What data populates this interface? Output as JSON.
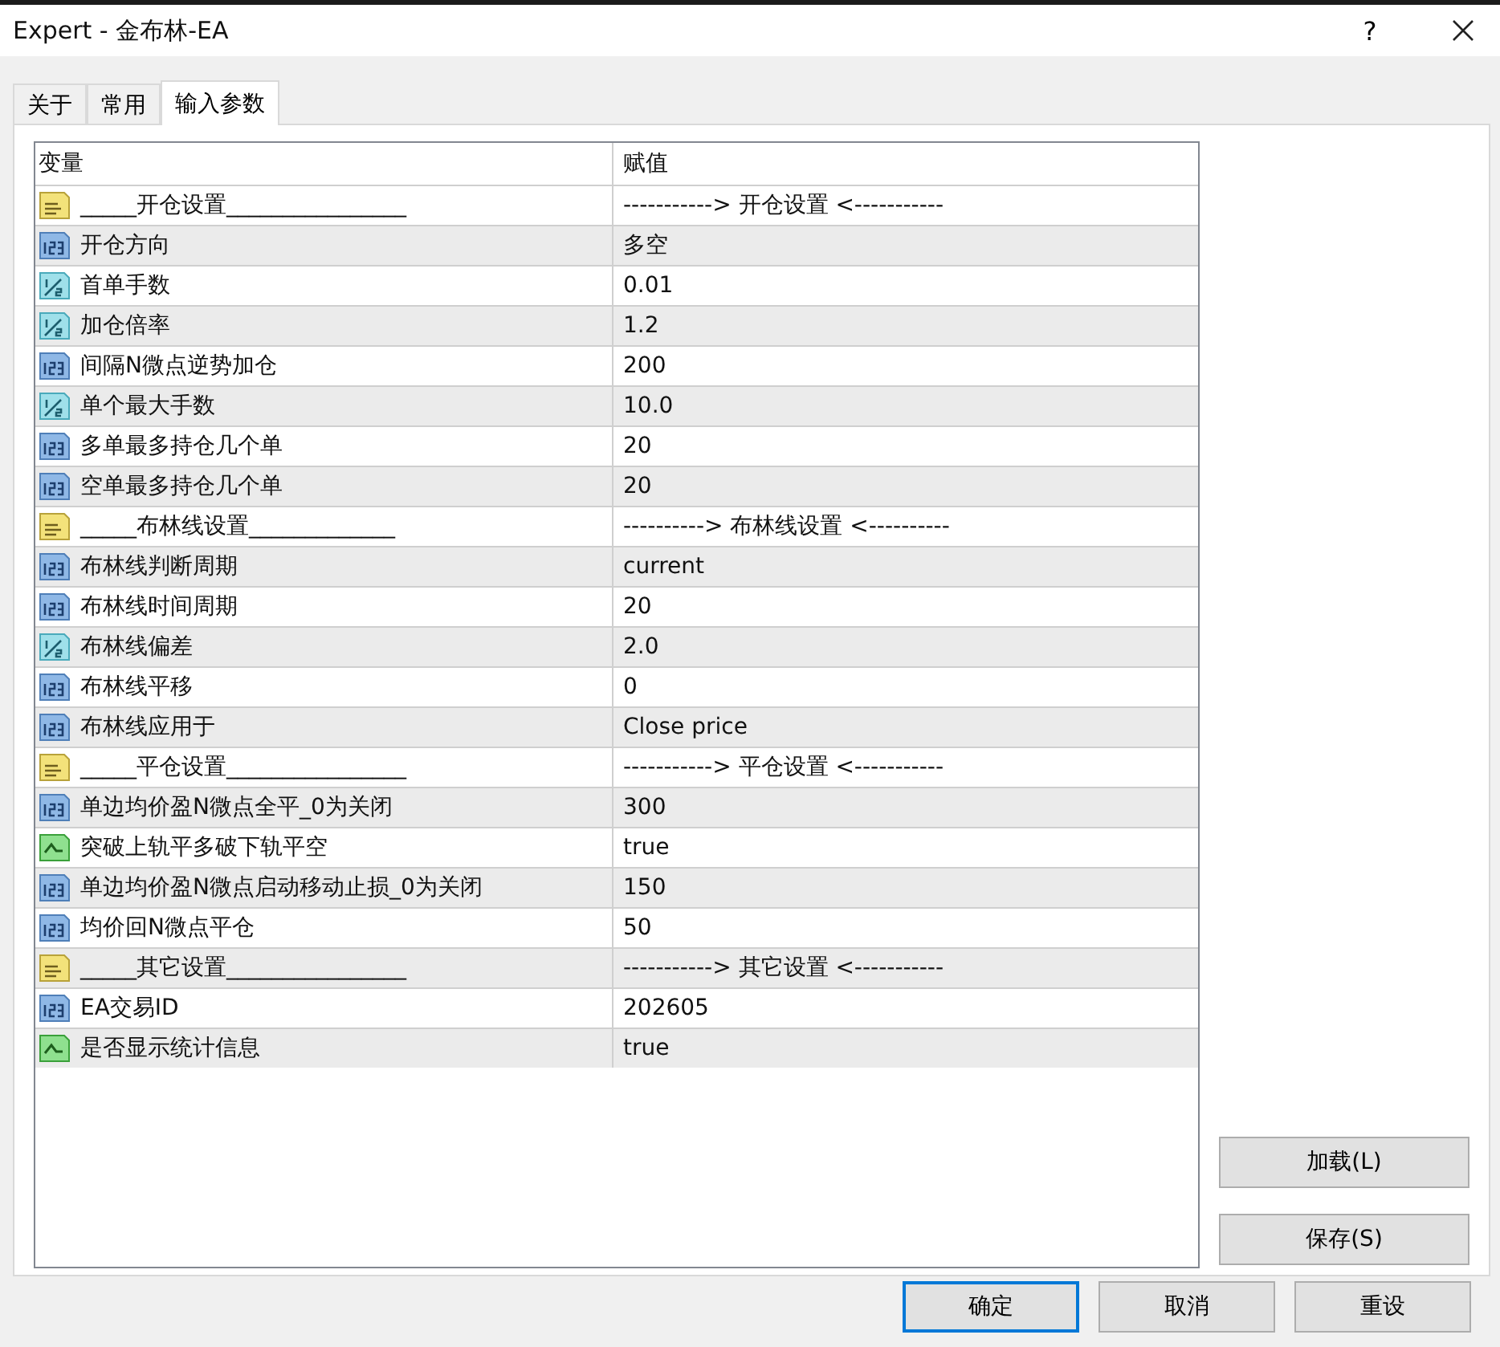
{
  "window": {
    "title": "Expert - 金布林-EA",
    "help": "?"
  },
  "tabs": [
    {
      "label": "关于",
      "selected": false
    },
    {
      "label": "常用",
      "selected": false
    },
    {
      "label": "输入参数",
      "selected": true
    }
  ],
  "table": {
    "columns": [
      "变量",
      "赋值"
    ],
    "rows": [
      {
        "kind": "string",
        "name": "_____开仓设置________________",
        "value": "-----------> 开仓设置 <-----------"
      },
      {
        "kind": "int",
        "name": "开仓方向",
        "value": "多空"
      },
      {
        "kind": "double",
        "name": "首单手数",
        "value": "0.01"
      },
      {
        "kind": "double",
        "name": "加仓倍率",
        "value": "1.2"
      },
      {
        "kind": "int",
        "name": "间隔N微点逆势加仓",
        "value": "200"
      },
      {
        "kind": "double",
        "name": "单个最大手数",
        "value": "10.0"
      },
      {
        "kind": "int",
        "name": "多单最多持仓几个单",
        "value": "20"
      },
      {
        "kind": "int",
        "name": "空单最多持仓几个单",
        "value": "20"
      },
      {
        "kind": "string",
        "name": "_____布林线设置_____________",
        "value": "----------> 布林线设置 <----------"
      },
      {
        "kind": "int",
        "name": "布林线判断周期",
        "value": "current"
      },
      {
        "kind": "int",
        "name": "布林线时间周期",
        "value": "20"
      },
      {
        "kind": "double",
        "name": "布林线偏差",
        "value": "2.0"
      },
      {
        "kind": "int",
        "name": "布林线平移",
        "value": "0"
      },
      {
        "kind": "int",
        "name": "布林线应用于",
        "value": "Close price"
      },
      {
        "kind": "string",
        "name": "_____平仓设置________________",
        "value": "-----------> 平仓设置 <-----------"
      },
      {
        "kind": "int",
        "name": "单边均价盈N微点全平_0为关闭",
        "value": "300"
      },
      {
        "kind": "bool",
        "name": "突破上轨平多破下轨平空",
        "value": "true"
      },
      {
        "kind": "int",
        "name": "单边均价盈N微点启动移动止损_0为关闭",
        "value": "150"
      },
      {
        "kind": "int",
        "name": "均价回N微点平仓",
        "value": "50"
      },
      {
        "kind": "string",
        "name": "_____其它设置________________",
        "value": "-----------> 其它设置 <-----------"
      },
      {
        "kind": "int",
        "name": "EA交易ID",
        "value": "202605"
      },
      {
        "kind": "bool",
        "name": "是否显示统计信息",
        "value": "true"
      }
    ]
  },
  "side_buttons": [
    "加载(L)",
    "保存(S)"
  ],
  "footer_buttons": [
    {
      "label": "确定",
      "selected": true
    },
    {
      "label": "取消",
      "selected": false
    },
    {
      "label": "重设",
      "selected": false
    }
  ]
}
